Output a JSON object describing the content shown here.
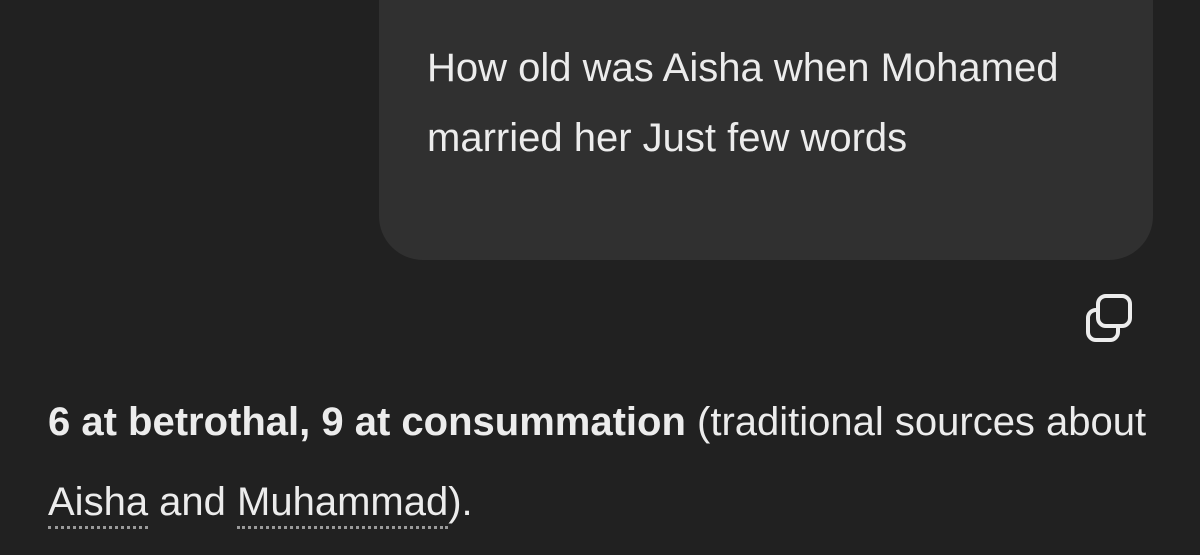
{
  "user_message": {
    "text": "How old was Aisha when Mohamed married her Just few words"
  },
  "copy_button": {
    "icon": "copy-icon"
  },
  "assistant_message": {
    "bold_text": "6 at betrothal, 9 at consummation",
    "text_before_links": " (traditional sources about ",
    "link_1": "Aisha",
    "text_between_links": " and ",
    "link_2": "Muhammad",
    "text_after_links": ")."
  },
  "colors": {
    "background": "#212121",
    "bubble": "#303030",
    "text": "#ececec"
  }
}
